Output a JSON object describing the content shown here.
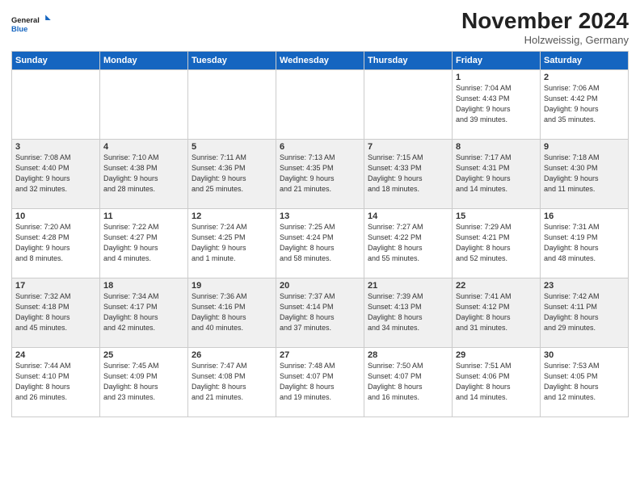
{
  "logo": {
    "line1": "General",
    "line2": "Blue"
  },
  "header": {
    "month": "November 2024",
    "location": "Holzweissig, Germany"
  },
  "weekdays": [
    "Sunday",
    "Monday",
    "Tuesday",
    "Wednesday",
    "Thursday",
    "Friday",
    "Saturday"
  ],
  "weeks": [
    [
      {
        "day": "",
        "info": ""
      },
      {
        "day": "",
        "info": ""
      },
      {
        "day": "",
        "info": ""
      },
      {
        "day": "",
        "info": ""
      },
      {
        "day": "",
        "info": ""
      },
      {
        "day": "1",
        "info": "Sunrise: 7:04 AM\nSunset: 4:43 PM\nDaylight: 9 hours\nand 39 minutes."
      },
      {
        "day": "2",
        "info": "Sunrise: 7:06 AM\nSunset: 4:42 PM\nDaylight: 9 hours\nand 35 minutes."
      }
    ],
    [
      {
        "day": "3",
        "info": "Sunrise: 7:08 AM\nSunset: 4:40 PM\nDaylight: 9 hours\nand 32 minutes."
      },
      {
        "day": "4",
        "info": "Sunrise: 7:10 AM\nSunset: 4:38 PM\nDaylight: 9 hours\nand 28 minutes."
      },
      {
        "day": "5",
        "info": "Sunrise: 7:11 AM\nSunset: 4:36 PM\nDaylight: 9 hours\nand 25 minutes."
      },
      {
        "day": "6",
        "info": "Sunrise: 7:13 AM\nSunset: 4:35 PM\nDaylight: 9 hours\nand 21 minutes."
      },
      {
        "day": "7",
        "info": "Sunrise: 7:15 AM\nSunset: 4:33 PM\nDaylight: 9 hours\nand 18 minutes."
      },
      {
        "day": "8",
        "info": "Sunrise: 7:17 AM\nSunset: 4:31 PM\nDaylight: 9 hours\nand 14 minutes."
      },
      {
        "day": "9",
        "info": "Sunrise: 7:18 AM\nSunset: 4:30 PM\nDaylight: 9 hours\nand 11 minutes."
      }
    ],
    [
      {
        "day": "10",
        "info": "Sunrise: 7:20 AM\nSunset: 4:28 PM\nDaylight: 9 hours\nand 8 minutes."
      },
      {
        "day": "11",
        "info": "Sunrise: 7:22 AM\nSunset: 4:27 PM\nDaylight: 9 hours\nand 4 minutes."
      },
      {
        "day": "12",
        "info": "Sunrise: 7:24 AM\nSunset: 4:25 PM\nDaylight: 9 hours\nand 1 minute."
      },
      {
        "day": "13",
        "info": "Sunrise: 7:25 AM\nSunset: 4:24 PM\nDaylight: 8 hours\nand 58 minutes."
      },
      {
        "day": "14",
        "info": "Sunrise: 7:27 AM\nSunset: 4:22 PM\nDaylight: 8 hours\nand 55 minutes."
      },
      {
        "day": "15",
        "info": "Sunrise: 7:29 AM\nSunset: 4:21 PM\nDaylight: 8 hours\nand 52 minutes."
      },
      {
        "day": "16",
        "info": "Sunrise: 7:31 AM\nSunset: 4:19 PM\nDaylight: 8 hours\nand 48 minutes."
      }
    ],
    [
      {
        "day": "17",
        "info": "Sunrise: 7:32 AM\nSunset: 4:18 PM\nDaylight: 8 hours\nand 45 minutes."
      },
      {
        "day": "18",
        "info": "Sunrise: 7:34 AM\nSunset: 4:17 PM\nDaylight: 8 hours\nand 42 minutes."
      },
      {
        "day": "19",
        "info": "Sunrise: 7:36 AM\nSunset: 4:16 PM\nDaylight: 8 hours\nand 40 minutes."
      },
      {
        "day": "20",
        "info": "Sunrise: 7:37 AM\nSunset: 4:14 PM\nDaylight: 8 hours\nand 37 minutes."
      },
      {
        "day": "21",
        "info": "Sunrise: 7:39 AM\nSunset: 4:13 PM\nDaylight: 8 hours\nand 34 minutes."
      },
      {
        "day": "22",
        "info": "Sunrise: 7:41 AM\nSunset: 4:12 PM\nDaylight: 8 hours\nand 31 minutes."
      },
      {
        "day": "23",
        "info": "Sunrise: 7:42 AM\nSunset: 4:11 PM\nDaylight: 8 hours\nand 29 minutes."
      }
    ],
    [
      {
        "day": "24",
        "info": "Sunrise: 7:44 AM\nSunset: 4:10 PM\nDaylight: 8 hours\nand 26 minutes."
      },
      {
        "day": "25",
        "info": "Sunrise: 7:45 AM\nSunset: 4:09 PM\nDaylight: 8 hours\nand 23 minutes."
      },
      {
        "day": "26",
        "info": "Sunrise: 7:47 AM\nSunset: 4:08 PM\nDaylight: 8 hours\nand 21 minutes."
      },
      {
        "day": "27",
        "info": "Sunrise: 7:48 AM\nSunset: 4:07 PM\nDaylight: 8 hours\nand 19 minutes."
      },
      {
        "day": "28",
        "info": "Sunrise: 7:50 AM\nSunset: 4:07 PM\nDaylight: 8 hours\nand 16 minutes."
      },
      {
        "day": "29",
        "info": "Sunrise: 7:51 AM\nSunset: 4:06 PM\nDaylight: 8 hours\nand 14 minutes."
      },
      {
        "day": "30",
        "info": "Sunrise: 7:53 AM\nSunset: 4:05 PM\nDaylight: 8 hours\nand 12 minutes."
      }
    ]
  ]
}
